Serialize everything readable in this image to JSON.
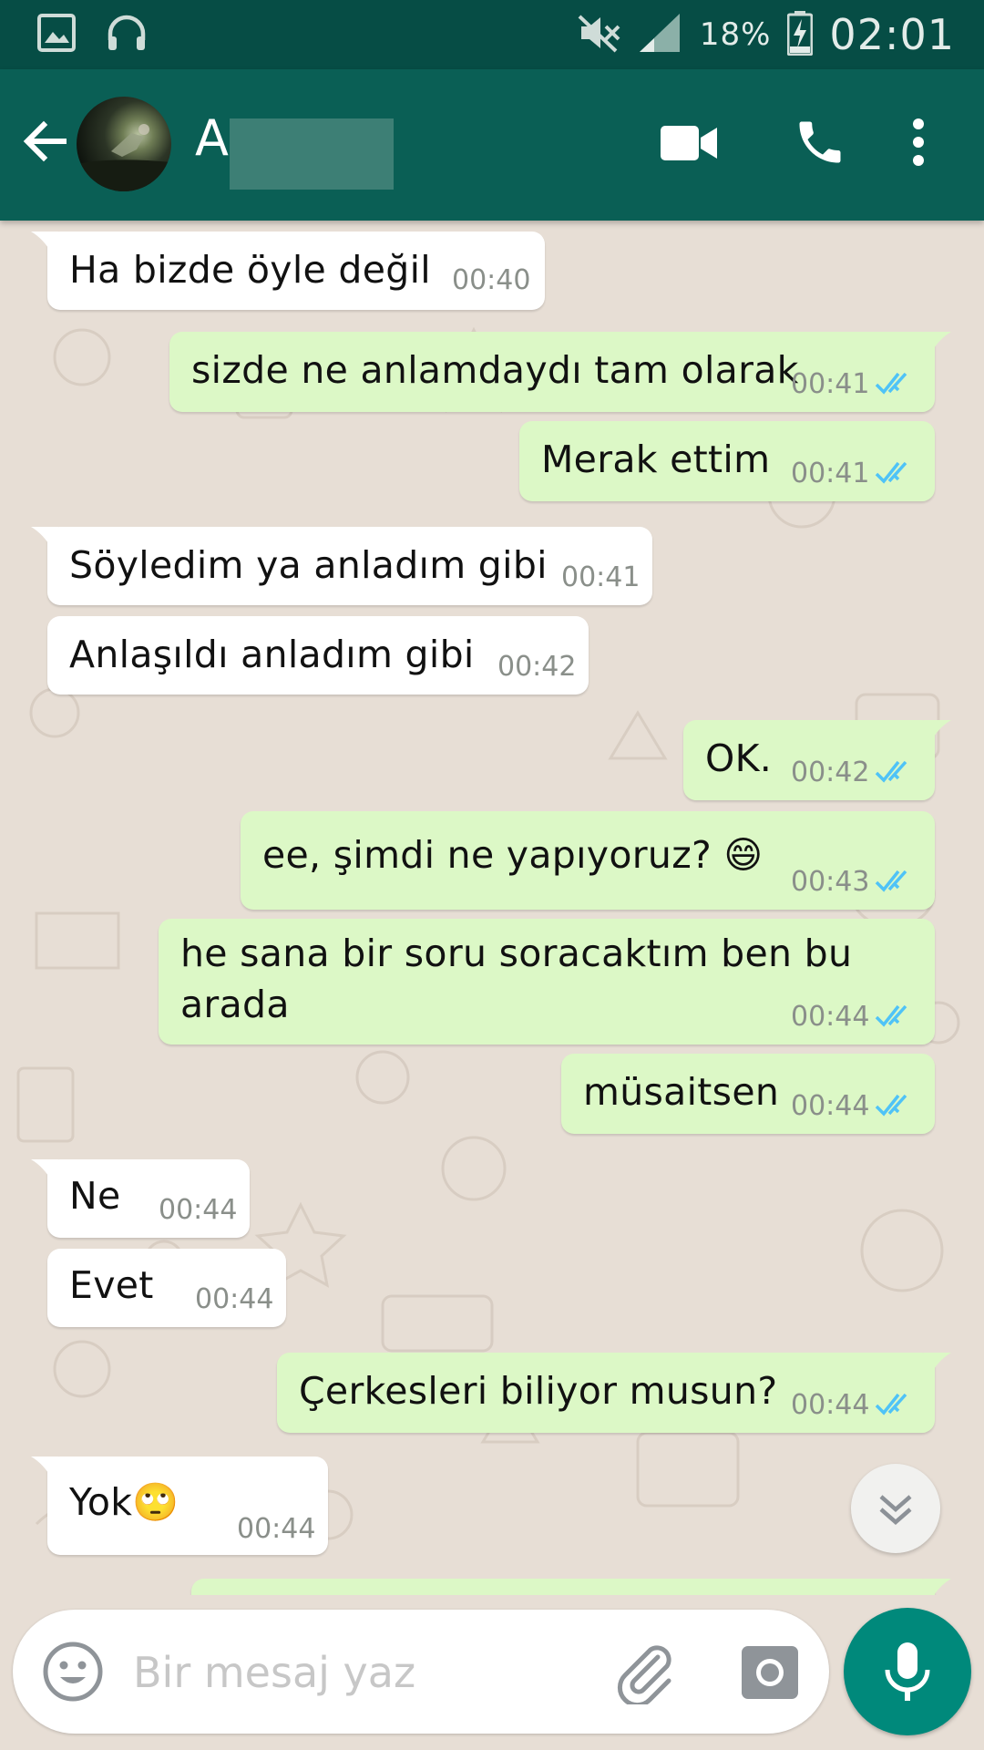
{
  "status_bar": {
    "battery_percent": "18%",
    "time": "02:01",
    "icons": [
      "gallery-icon",
      "headset-icon",
      "mute-icon",
      "signal-icon",
      "battery-charging-icon"
    ]
  },
  "toolbar": {
    "contact_name": "A",
    "icons": [
      "back-arrow-icon",
      "video-call-icon",
      "phone-icon",
      "more-vert-icon"
    ]
  },
  "messages": [
    {
      "dir": "in",
      "text": "Ha bizde öyle değil",
      "time": "00:40",
      "tail": true
    },
    {
      "dir": "out",
      "text": "sizde ne anlamdaydı tam olarak",
      "time": "00:41",
      "ticks": "read",
      "tail": true
    },
    {
      "dir": "out",
      "text": "Merak ettim",
      "time": "00:41",
      "ticks": "read"
    },
    {
      "dir": "in",
      "text": "Söyledim ya anladım gibi",
      "time": "00:41",
      "tail": true
    },
    {
      "dir": "in",
      "text": "Anlaşıldı anladım gibi",
      "time": "00:42"
    },
    {
      "dir": "out",
      "text": "OK.",
      "time": "00:42",
      "ticks": "read",
      "tail": true
    },
    {
      "dir": "out",
      "text": "ee, şimdi ne yapıyoruz? 😄",
      "time": "00:43",
      "ticks": "read"
    },
    {
      "dir": "out",
      "text": "he sana bir soru soracaktım ben bu",
      "text2": "arada",
      "time": "00:44",
      "ticks": "read"
    },
    {
      "dir": "out",
      "text": "müsaitsen",
      "time": "00:44",
      "ticks": "read"
    },
    {
      "dir": "in",
      "text": "Ne",
      "time": "00:44",
      "tail": true
    },
    {
      "dir": "in",
      "text": "Evet",
      "time": "00:44"
    },
    {
      "dir": "out",
      "text": "Çerkesleri biliyor musun?",
      "time": "00:44",
      "ticks": "read",
      "tail": true
    },
    {
      "dir": "in",
      "text": "Yok🙄",
      "time": "00:44",
      "tail": true
    }
  ],
  "composer": {
    "placeholder": "Bir mesaj yaz",
    "value": ""
  },
  "colors": {
    "status_bar": "#064d45",
    "toolbar": "#0a5f55",
    "chat_background": "#e7ded5",
    "incoming_bubble": "#ffffff",
    "outgoing_bubble": "#dcf8c6",
    "read_ticks": "#4fc3f7",
    "mic_button": "#00897b"
  }
}
